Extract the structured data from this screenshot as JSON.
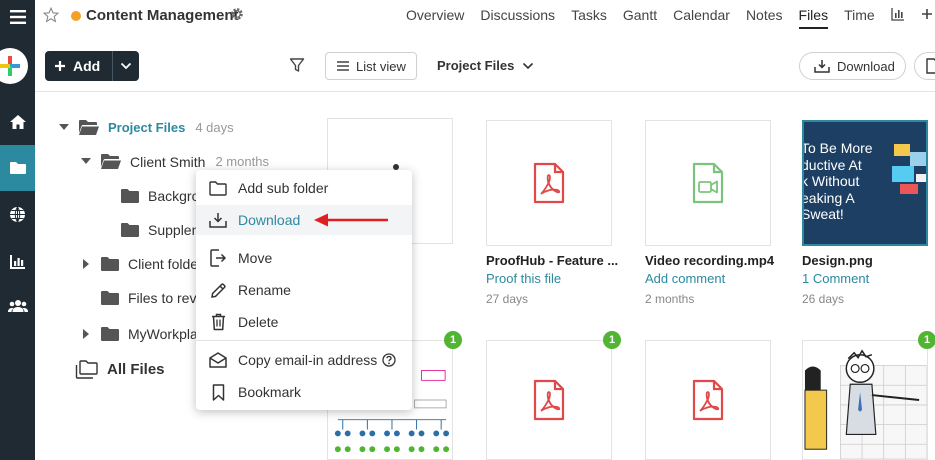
{
  "project": {
    "title": "Content Management",
    "dot_color": "#f4a024"
  },
  "tabs": [
    {
      "label": "Overview"
    },
    {
      "label": "Discussions"
    },
    {
      "label": "Tasks"
    },
    {
      "label": "Gantt"
    },
    {
      "label": "Calendar"
    },
    {
      "label": "Notes"
    },
    {
      "label": "Files",
      "active": true
    },
    {
      "label": "Time"
    }
  ],
  "toolbar": {
    "add_label": "Add",
    "list_view_label": "List view",
    "folder_select": "Project Files",
    "download_label": "Download"
  },
  "tree": {
    "root": {
      "label": "Project Files",
      "age": "4 days"
    },
    "client_smith": {
      "label": "Client Smith",
      "age": "2 months"
    },
    "background": {
      "label": "Backgro"
    },
    "supplements": {
      "label": "Supplen"
    },
    "client_folder": {
      "label": "Client folde"
    },
    "files_to_review": {
      "label": "Files to revi"
    },
    "my_workplace": {
      "label": "MyWorkplac"
    },
    "all_files": {
      "label": "All Files"
    }
  },
  "files": [
    {
      "name": "ProofHub - Feature ...",
      "action": "Proof this file",
      "age": "27 days",
      "type": "pdf"
    },
    {
      "name": "Video recording.mp4",
      "action": "Add comment",
      "age": "2 months",
      "type": "video"
    },
    {
      "name": "Design.png",
      "action": "1 Comment",
      "age": "26 days",
      "type": "image"
    }
  ],
  "design_thumb": {
    "lines": [
      "To Be More",
      "ductive At",
      "k Without",
      "eaking A",
      "Sweat!"
    ]
  },
  "badges": [
    "1",
    "1",
    "1"
  ],
  "context_menu": {
    "items": [
      {
        "label": "Add sub folder"
      },
      {
        "label": "Download"
      },
      {
        "label": "Move"
      },
      {
        "label": "Rename"
      },
      {
        "label": "Delete"
      },
      {
        "label": "Copy email-in address"
      },
      {
        "label": "Bookmark"
      }
    ]
  },
  "colors": {
    "accent": "#2c8aa0",
    "rail": "#1f2a33",
    "pdf_red": "#e14848",
    "video_green": "#7cc47b",
    "badge_green": "#52b433",
    "arrow_red": "#e02020"
  }
}
